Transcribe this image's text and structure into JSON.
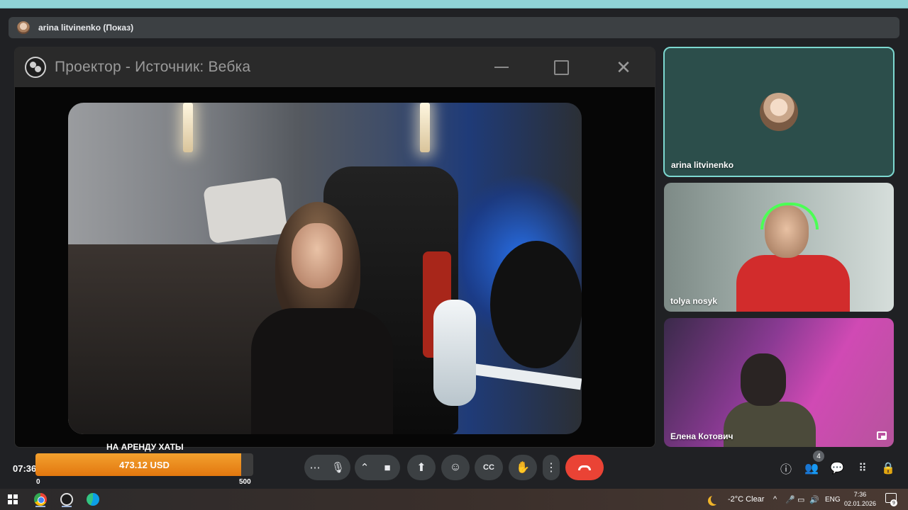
{
  "presenter_bar": {
    "label": "arina litvinenko (Показ)"
  },
  "projector": {
    "title": "Проектор - Источник: Вебка",
    "close_glyph": "✕"
  },
  "participants": [
    {
      "name": "arina litvinenko",
      "active_speaker": true
    },
    {
      "name": "tolya nosyk"
    },
    {
      "name": "Елена Котович"
    }
  ],
  "donation": {
    "title": "НА АРЕНДУ ХАТЫ",
    "amount_label": "473.12 USD",
    "current": 473.12,
    "min_label": "0",
    "max_label": "500",
    "min": 0,
    "max": 500,
    "accent": "#e98a1c"
  },
  "clock": "07:36",
  "controls": {
    "more_glyph": "⋯",
    "mic_glyph": "🎙",
    "chevron_glyph": "⌃",
    "camera_glyph": "■",
    "present_glyph": "⬆",
    "emoji_glyph": "☺",
    "captions_glyph": "CC",
    "hand_glyph": "✋",
    "options_glyph": "⋮",
    "hangup_color": "#ea4335"
  },
  "right_controls": {
    "info_glyph": "ⓘ",
    "people_glyph": "👥",
    "people_count": "4",
    "chat_glyph": "💬",
    "apps_glyph": "⠿",
    "lock_glyph": "🔒"
  },
  "taskbar": {
    "weather": "-2°C  Clear",
    "language": "ENG",
    "time": "7:36",
    "date": "02.01.2026",
    "notifications": "9",
    "tray_up_glyph": "^",
    "mic_glyph": "🎤",
    "battery_glyph": "▭",
    "volume_glyph": "🔊"
  }
}
